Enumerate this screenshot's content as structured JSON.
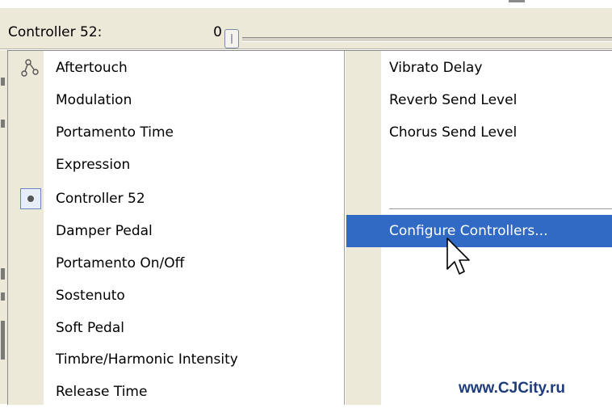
{
  "toolbar": {
    "controller_label": "Controller 52:",
    "controller_value": "0"
  },
  "menu": {
    "left_items": [
      {
        "label": "Aftertouch",
        "icon": "nodes-icon"
      },
      {
        "label": "Modulation"
      },
      {
        "label": "Portamento Time"
      },
      {
        "label": "Expression"
      },
      {
        "label": "Controller 52",
        "checked": true
      },
      {
        "label": "Damper Pedal"
      },
      {
        "label": "Portamento On/Off"
      },
      {
        "label": "Sostenuto"
      },
      {
        "label": "Soft Pedal"
      },
      {
        "label": "Timbre/Harmonic Intensity"
      },
      {
        "label": "Release Time"
      }
    ],
    "right_items": [
      {
        "label": "Vibrato Delay"
      },
      {
        "label": "Reverb Send Level"
      },
      {
        "label": "Chorus Send Level"
      }
    ],
    "configure_label": "Configure Controllers..."
  },
  "watermark": "www.CJCity.ru",
  "colors": {
    "menu_gutter": "#ece9d8",
    "highlight": "#316ac5",
    "watermark": "#1f3c7a"
  }
}
